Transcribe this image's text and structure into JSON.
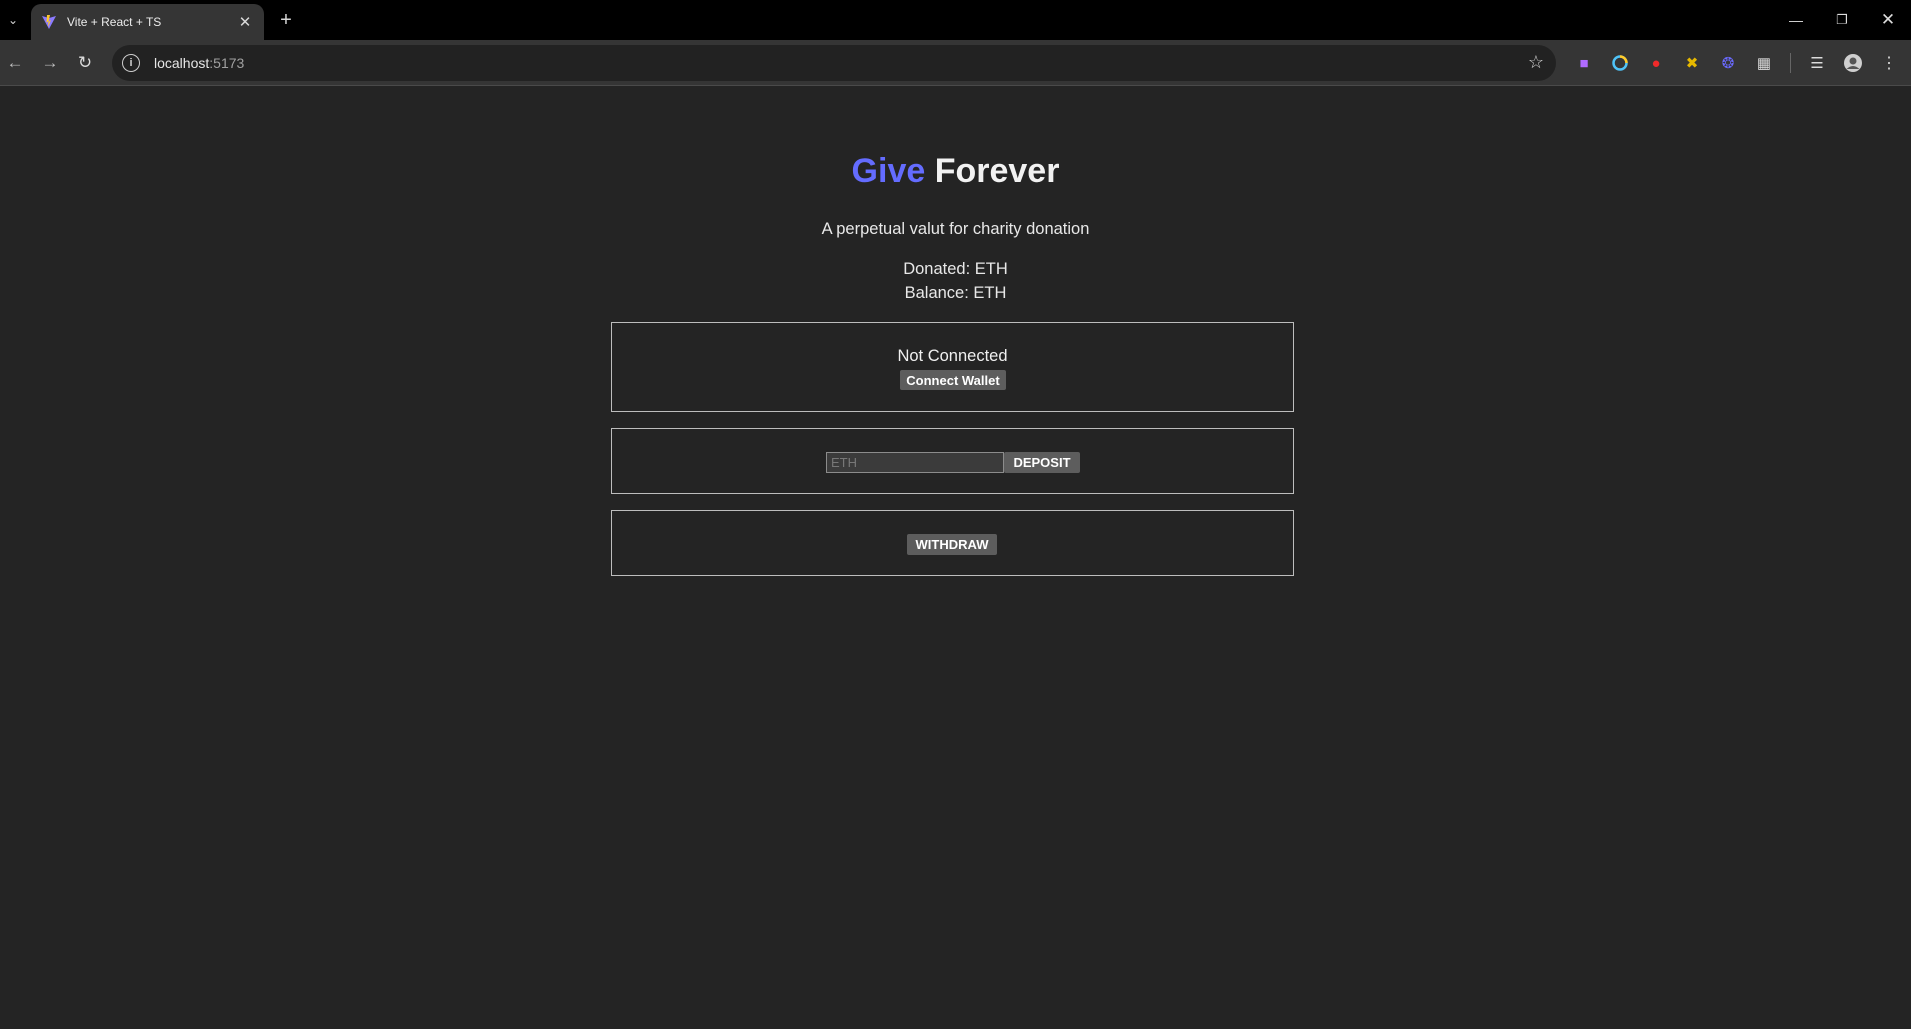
{
  "browser": {
    "tab": {
      "title": "Vite + React + TS"
    },
    "address": {
      "host": "localhost",
      "port": ":5173"
    },
    "icons": {
      "tab_list": "chevron-down-icon",
      "new_tab": "plus-icon",
      "minimize": "minimize-icon",
      "restore": "restore-icon",
      "close": "close-icon",
      "back": "back-arrow-icon",
      "forward": "forward-arrow-icon",
      "reload": "reload-icon",
      "site_info": "info-icon",
      "bookmark": "star-icon",
      "extensions": "puzzle-icon",
      "media": "media-control-icon",
      "profile": "profile-avatar-icon",
      "menu": "kebab-menu-icon"
    }
  },
  "app": {
    "title_accent": "Give",
    "title_rest": "Forever",
    "subtitle": "A perpetual valut for charity donation",
    "donated": "Donated: ETH",
    "balance": "Balance: ETH",
    "connection_status": "Not Connected",
    "connect_button": "Connect Wallet",
    "deposit_placeholder": "ETH",
    "deposit_button": "DEPOSIT",
    "withdraw_button": "WITHDRAW"
  },
  "colors": {
    "page_background": "#242424",
    "accent": "#646cff",
    "button_background": "#5d5d5d"
  }
}
